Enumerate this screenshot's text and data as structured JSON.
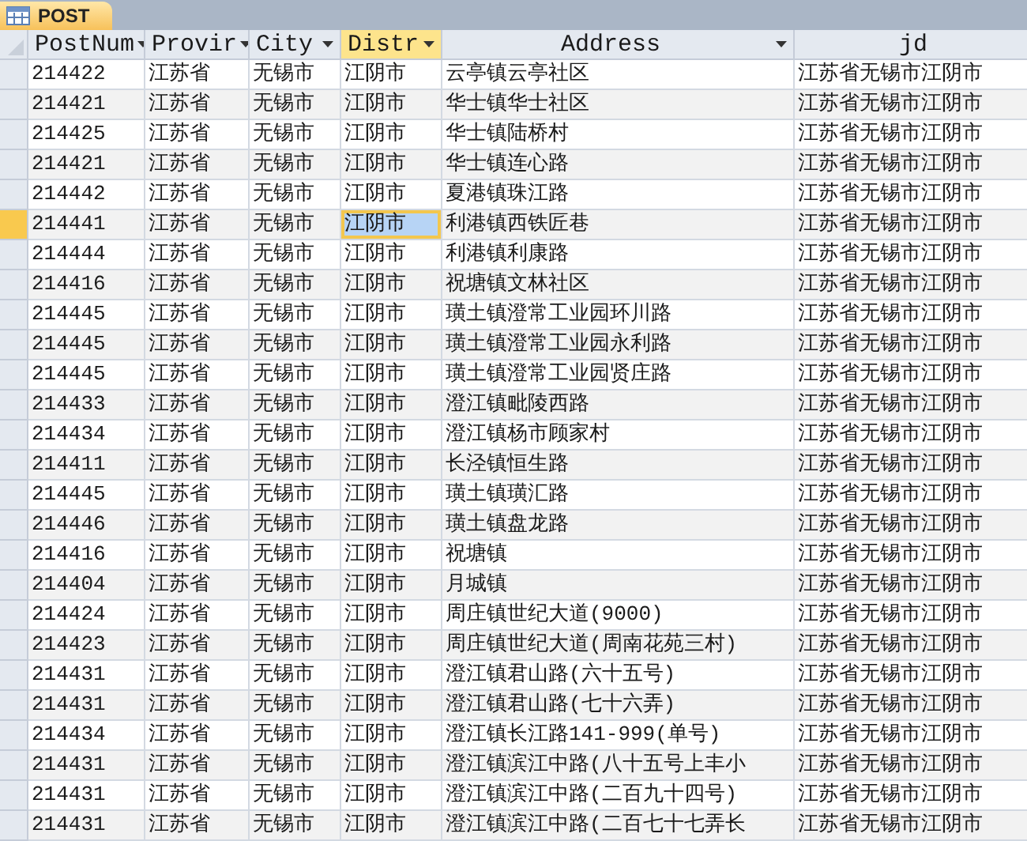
{
  "tab": {
    "title": "POST",
    "selected": true
  },
  "table": {
    "columns": [
      {
        "label": "PostNum",
        "selected": false
      },
      {
        "label": "Provir",
        "selected": false
      },
      {
        "label": "City",
        "selected": false
      },
      {
        "label": "Distr",
        "selected": true
      },
      {
        "label": "Address",
        "selected": false
      },
      {
        "label": "jd",
        "selected": false
      }
    ],
    "rows": [
      {
        "selected": false,
        "cells": [
          "214422",
          "江苏省",
          "无锡市",
          "江阴市",
          "云亭镇云亭社区",
          "江苏省无锡市江阴市"
        ]
      },
      {
        "selected": false,
        "cells": [
          "214421",
          "江苏省",
          "无锡市",
          "江阴市",
          "华士镇华士社区",
          "江苏省无锡市江阴市"
        ]
      },
      {
        "selected": false,
        "cells": [
          "214425",
          "江苏省",
          "无锡市",
          "江阴市",
          "华士镇陆桥村",
          "江苏省无锡市江阴市"
        ]
      },
      {
        "selected": false,
        "cells": [
          "214421",
          "江苏省",
          "无锡市",
          "江阴市",
          "华士镇连心路",
          "江苏省无锡市江阴市"
        ]
      },
      {
        "selected": false,
        "cells": [
          "214442",
          "江苏省",
          "无锡市",
          "江阴市",
          "夏港镇珠江路",
          "江苏省无锡市江阴市"
        ]
      },
      {
        "selected": true,
        "cells": [
          "214441",
          "江苏省",
          "无锡市",
          "江阴市",
          "利港镇西铁匠巷",
          "江苏省无锡市江阴市"
        ]
      },
      {
        "selected": false,
        "cells": [
          "214444",
          "江苏省",
          "无锡市",
          "江阴市",
          "利港镇利康路",
          "江苏省无锡市江阴市"
        ]
      },
      {
        "selected": false,
        "cells": [
          "214416",
          "江苏省",
          "无锡市",
          "江阴市",
          "祝塘镇文林社区",
          "江苏省无锡市江阴市"
        ]
      },
      {
        "selected": false,
        "cells": [
          "214445",
          "江苏省",
          "无锡市",
          "江阴市",
          "璜土镇澄常工业园环川路",
          "江苏省无锡市江阴市"
        ]
      },
      {
        "selected": false,
        "cells": [
          "214445",
          "江苏省",
          "无锡市",
          "江阴市",
          "璜土镇澄常工业园永利路",
          "江苏省无锡市江阴市"
        ]
      },
      {
        "selected": false,
        "cells": [
          "214445",
          "江苏省",
          "无锡市",
          "江阴市",
          "璜土镇澄常工业园贤庄路",
          "江苏省无锡市江阴市"
        ]
      },
      {
        "selected": false,
        "cells": [
          "214433",
          "江苏省",
          "无锡市",
          "江阴市",
          "澄江镇毗陵西路",
          "江苏省无锡市江阴市"
        ]
      },
      {
        "selected": false,
        "cells": [
          "214434",
          "江苏省",
          "无锡市",
          "江阴市",
          "澄江镇杨市顾家村",
          "江苏省无锡市江阴市"
        ]
      },
      {
        "selected": false,
        "cells": [
          "214411",
          "江苏省",
          "无锡市",
          "江阴市",
          "长泾镇恒生路",
          "江苏省无锡市江阴市"
        ]
      },
      {
        "selected": false,
        "cells": [
          "214445",
          "江苏省",
          "无锡市",
          "江阴市",
          "璜土镇璜汇路",
          "江苏省无锡市江阴市"
        ]
      },
      {
        "selected": false,
        "cells": [
          "214446",
          "江苏省",
          "无锡市",
          "江阴市",
          "璜土镇盘龙路",
          "江苏省无锡市江阴市"
        ]
      },
      {
        "selected": false,
        "cells": [
          "214416",
          "江苏省",
          "无锡市",
          "江阴市",
          "祝塘镇",
          "江苏省无锡市江阴市"
        ]
      },
      {
        "selected": false,
        "cells": [
          "214404",
          "江苏省",
          "无锡市",
          "江阴市",
          "月城镇",
          "江苏省无锡市江阴市"
        ]
      },
      {
        "selected": false,
        "cells": [
          "214424",
          "江苏省",
          "无锡市",
          "江阴市",
          "周庄镇世纪大道(9000)",
          "江苏省无锡市江阴市"
        ]
      },
      {
        "selected": false,
        "cells": [
          "214423",
          "江苏省",
          "无锡市",
          "江阴市",
          "周庄镇世纪大道(周南花苑三村)",
          "江苏省无锡市江阴市"
        ]
      },
      {
        "selected": false,
        "cells": [
          "214431",
          "江苏省",
          "无锡市",
          "江阴市",
          "澄江镇君山路(六十五号)",
          "江苏省无锡市江阴市"
        ]
      },
      {
        "selected": false,
        "cells": [
          "214431",
          "江苏省",
          "无锡市",
          "江阴市",
          "澄江镇君山路(七十六弄)",
          "江苏省无锡市江阴市"
        ]
      },
      {
        "selected": false,
        "cells": [
          "214434",
          "江苏省",
          "无锡市",
          "江阴市",
          "澄江镇长江路141-999(单号)",
          "江苏省无锡市江阴市"
        ]
      },
      {
        "selected": false,
        "cells": [
          "214431",
          "江苏省",
          "无锡市",
          "江阴市",
          "澄江镇滨江中路(八十五号上丰小",
          "江苏省无锡市江阴市"
        ]
      },
      {
        "selected": false,
        "cells": [
          "214431",
          "江苏省",
          "无锡市",
          "江阴市",
          "澄江镇滨江中路(二百九十四号)",
          "江苏省无锡市江阴市"
        ]
      },
      {
        "selected": false,
        "cells": [
          "214431",
          "江苏省",
          "无锡市",
          "江阴市",
          "澄江镇滨江中路(二百七十七弄长",
          "江苏省无锡市江阴市"
        ]
      }
    ]
  }
}
